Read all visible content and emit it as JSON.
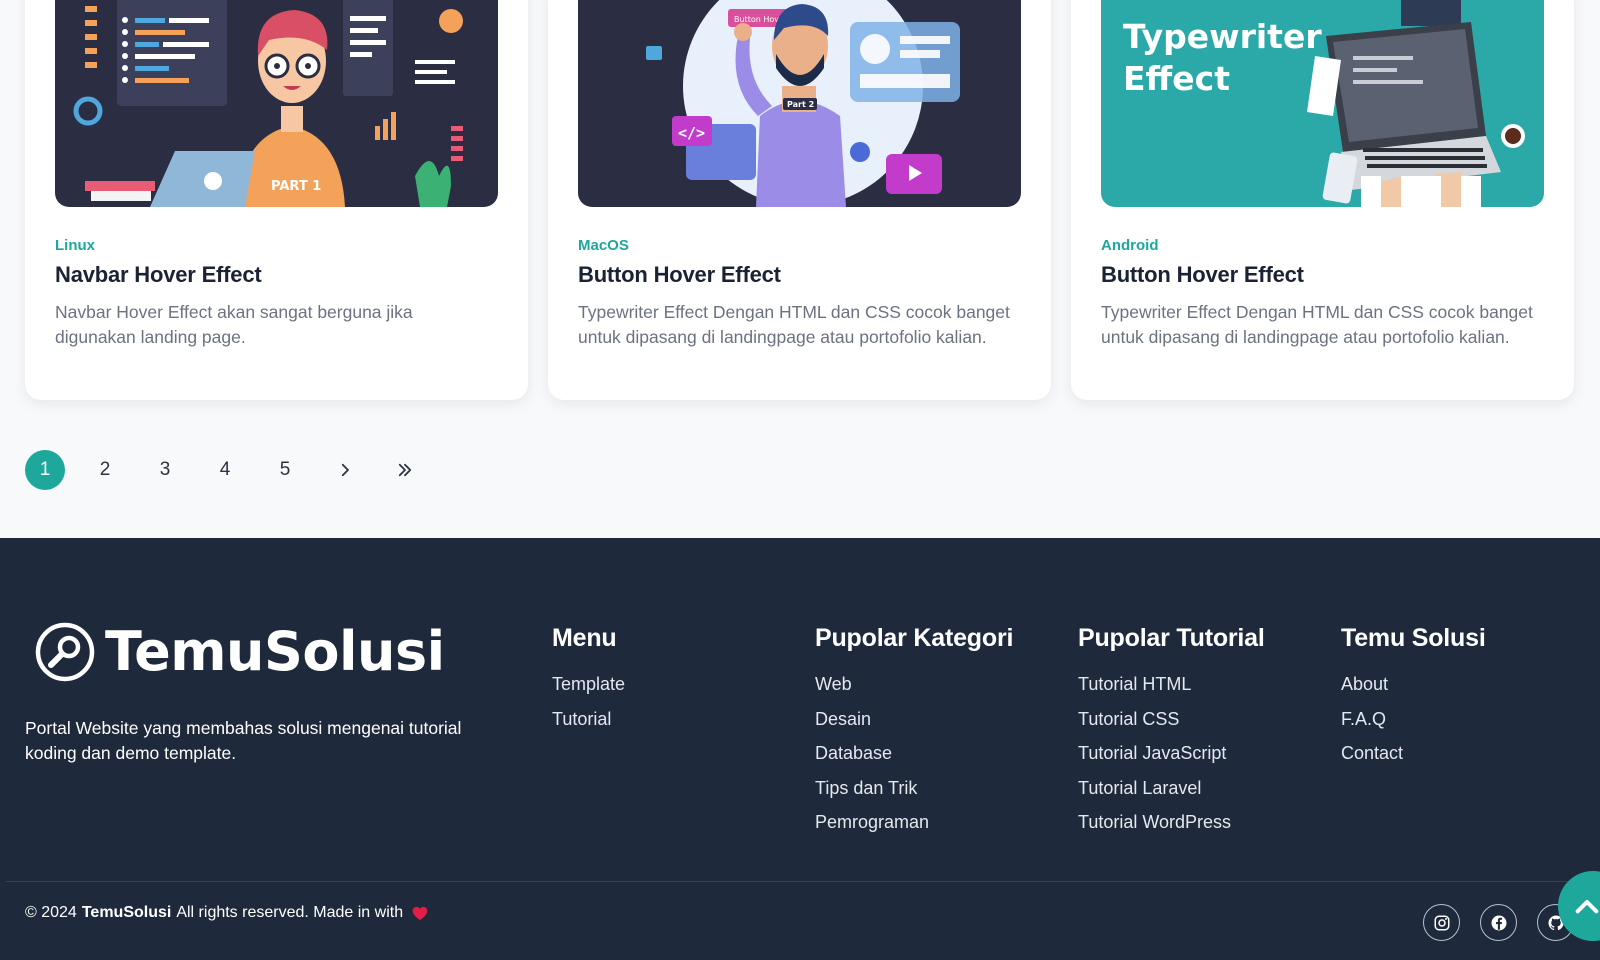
{
  "cards": [
    {
      "category": "Linux",
      "title": "Navbar Hover Effect",
      "description": "Navbar Hover Effect akan sangat berguna jika digunakan landing page.",
      "thumb_label": "PART 1"
    },
    {
      "category": "MacOS",
      "title": "Button Hover Effect",
      "description": "Typewriter Effect Dengan HTML dan CSS cocok banget untuk dipasang di landingpage atau portofolio kalian.",
      "thumb_label": "Button Hover Effect",
      "thumb_shirt": "Part 2"
    },
    {
      "category": "Android",
      "title": "Button Hover Effect",
      "description": "Typewriter Effect Dengan HTML dan CSS cocok banget untuk dipasang di landingpage atau portofolio kalian.",
      "thumb_label": "Typewriter Effect"
    }
  ],
  "pagination": {
    "pages": [
      "1",
      "2",
      "3",
      "4",
      "5"
    ],
    "current": "1"
  },
  "footer": {
    "brand": "TemuSolusi",
    "description": "Portal Website yang membahas solusi mengenai tutorial koding dan demo template.",
    "columns": [
      {
        "title": "Menu",
        "links": [
          "Template",
          "Tutorial"
        ]
      },
      {
        "title": "Pupolar Kategori",
        "links": [
          "Web",
          "Desain",
          "Database",
          "Tips dan Trik",
          "Pemrograman"
        ]
      },
      {
        "title": "Pupolar Tutorial",
        "links": [
          "Tutorial HTML",
          "Tutorial CSS",
          "Tutorial JavaScript",
          "Tutorial Laravel",
          "Tutorial WordPress"
        ]
      },
      {
        "title": "Temu Solusi",
        "links": [
          "About",
          "F.A.Q",
          "Contact"
        ]
      }
    ],
    "copyright_prefix": "© 2024",
    "copyright_brand": "TemuSolusi",
    "copyright_suffix": "All rights reserved. Made in with",
    "socials": [
      "instagram-icon",
      "facebook-icon",
      "github-icon"
    ]
  },
  "colors": {
    "accent": "#1ea89c",
    "footer_bg": "#1e293b",
    "card_bg": "#ffffff",
    "page_bg": "#f8f9fb",
    "heart": "#e11d48"
  }
}
